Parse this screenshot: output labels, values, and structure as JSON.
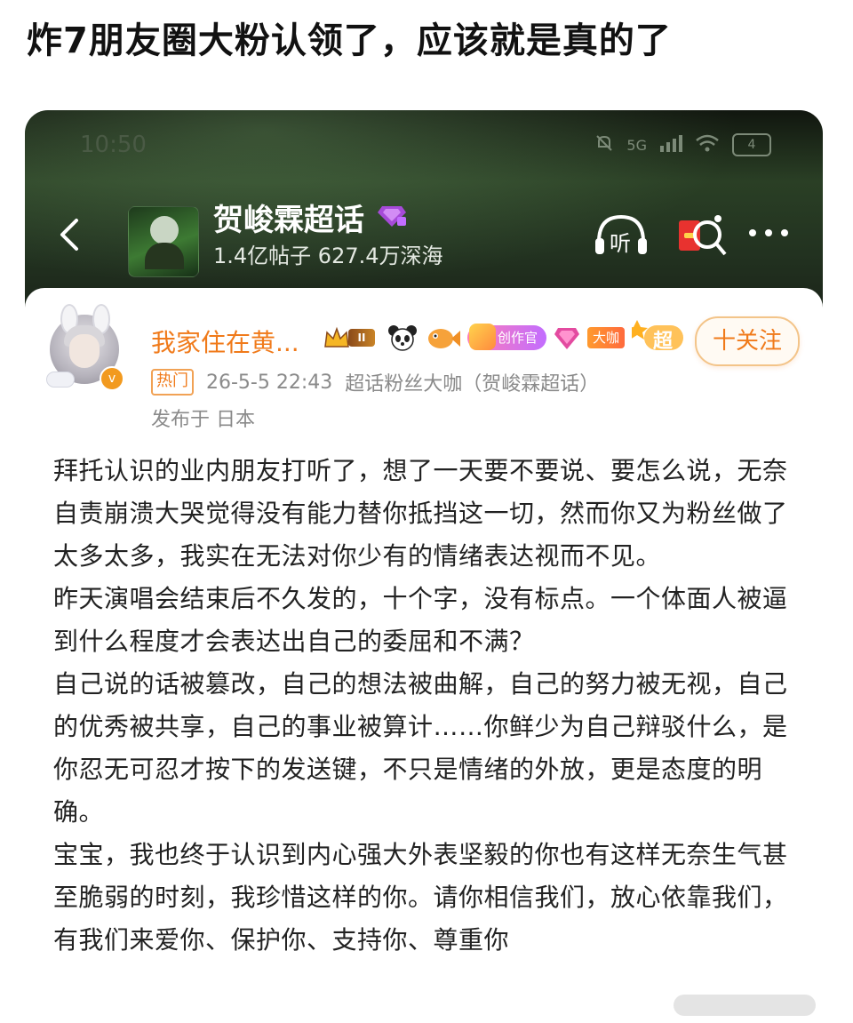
{
  "headline": "炸7朋友圈大粉认领了，应该就是真的了",
  "status_bar": {
    "time": "10:50",
    "network": "5G",
    "battery": "4"
  },
  "topic": {
    "name": "贺峻霖超话",
    "stats": "1.4亿帖子 627.4万深海",
    "listen_label": "听"
  },
  "post": {
    "username": "我家住在黄...",
    "level_badge": "II",
    "creator_badge": "创作官",
    "dk_badge": "大咖",
    "super_badge": "超",
    "follow_label": "十关注",
    "hot_tag": "热门",
    "timestamp": "26-5-5 22:43",
    "source": "超话粉丝大咖（贺峻霖超话）",
    "location": "发布于 日本",
    "paragraphs": [
      "拜托认识的业内朋友打听了，想了一天要不要说、要怎么说，无奈自责崩溃大哭觉得没有能力替你抵挡这一切，然而你又为粉丝做了太多太多，我实在无法对你少有的情绪表达视而不见。",
      "昨天演唱会结束后不久发的，十个字，没有标点。一个体面人被逼到什么程度才会表达出自己的委屈和不满？",
      "自己说的话被篡改，自己的想法被曲解，自己的努力被无视，自己的优秀被共享，自己的事业被算计……你鲜少为自己辩驳什么，是你忍无可忍才按下的发送键，不只是情绪的外放，更是态度的明确。",
      "宝宝，我也终于认识到内心强大外表坚毅的你也有这样无奈生气甚至脆弱的时刻，我珍惜这样的你。请你相信我们，放心依靠我们，有我们来爱你、保护你、支持你、尊重你"
    ]
  },
  "icons": {
    "back": "chevron-left-icon",
    "gem": "gem-icon",
    "listen": "headphones-icon",
    "redpacket": "red-packet-icon",
    "more": "more-icon",
    "verify": "verified-icon"
  },
  "colors": {
    "accent": "#f07a1a",
    "header_bg": "#223220",
    "gem": "#a64ad8"
  }
}
